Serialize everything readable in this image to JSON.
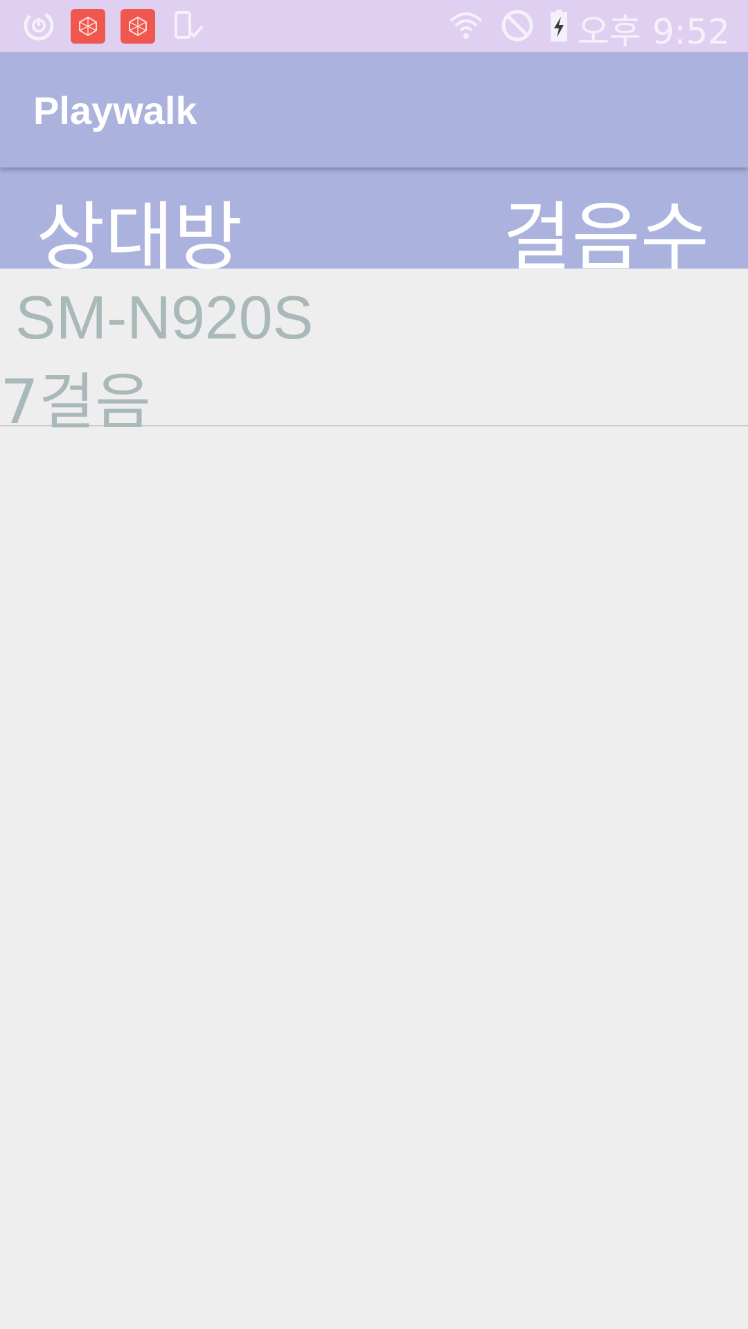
{
  "status_bar": {
    "time": "오후 9:52",
    "icons": [
      "sync-icon",
      "app-icon",
      "app-icon",
      "phone-check-icon",
      "wifi-icon",
      "do-not-disturb-icon",
      "battery-charging-icon"
    ],
    "background_color": "#dfcff1"
  },
  "app_bar": {
    "title": "Playwalk",
    "background_color": "#aab2dd"
  },
  "table_header": {
    "opponent_label": "상대방",
    "steps_label": "걸음수"
  },
  "list": {
    "items": [
      {
        "name": "SM-N920S",
        "steps": "7걸음"
      }
    ]
  },
  "colors": {
    "accent": "#aab2dd",
    "list_text": "#a9b8b8",
    "background": "#eeeeef"
  }
}
